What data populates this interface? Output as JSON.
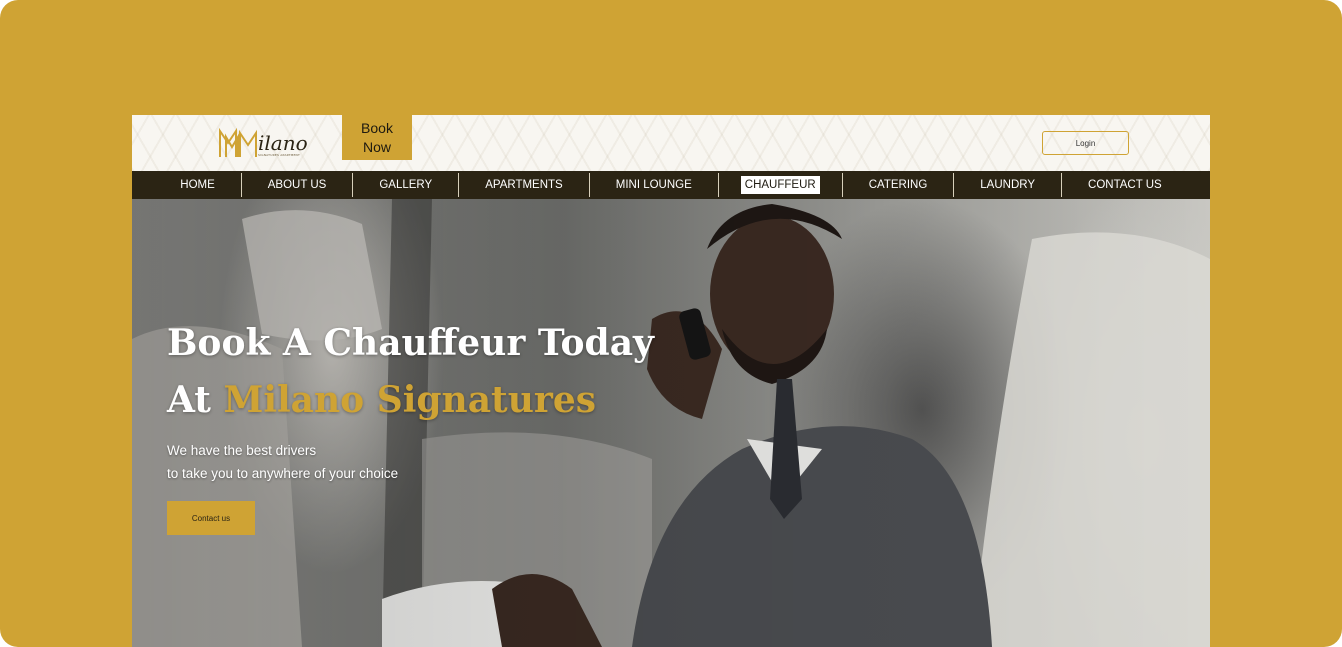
{
  "logo": {
    "wordmark": "Milano",
    "tagline": "SIGNATURES APARTMENT"
  },
  "header": {
    "book_now_label": "Book Now",
    "login_label": "Login"
  },
  "nav": {
    "items": [
      {
        "label": "HOME"
      },
      {
        "label": "ABOUT US"
      },
      {
        "label": "GALLERY"
      },
      {
        "label": "APARTMENTS"
      },
      {
        "label": "MINI LOUNGE"
      },
      {
        "label": "CHAUFFEUR"
      },
      {
        "label": "CATERING"
      },
      {
        "label": "LAUNDRY"
      },
      {
        "label": "CONTACT US"
      }
    ],
    "active": "CHAUFFEUR"
  },
  "hero": {
    "title_line1": "Book A Chauffeur Today",
    "title_line2_prefix": "At ",
    "title_line2_accent": "Milano Signatures",
    "subtitle_line1": "We have the best drivers",
    "subtitle_line2": "to take you to anywhere of your choice",
    "cta_label": "Contact us"
  },
  "colors": {
    "brand_gold": "#cfa334",
    "nav_bg": "#2b2414",
    "header_bg": "#f8f6f1",
    "text_white": "#ffffff"
  }
}
